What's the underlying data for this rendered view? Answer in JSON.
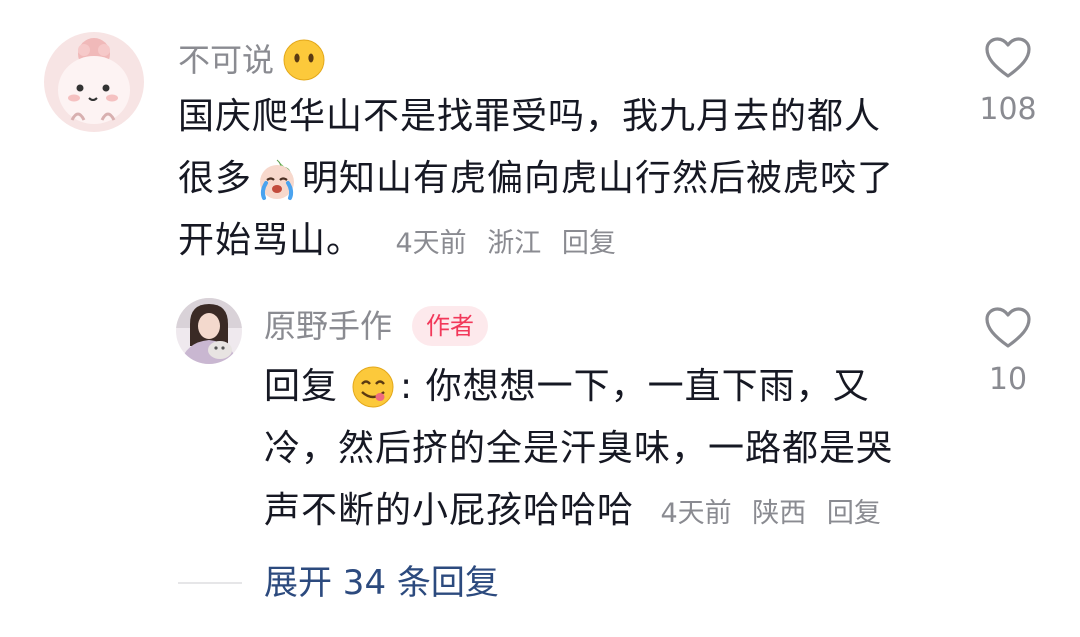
{
  "comment": {
    "username": "不可说",
    "username_emoji": "neutral-face-emoji",
    "lines": [
      "国庆爬华山不是找罪受吗，我九月去的都人",
      "很多",
      "明知山有虎偏向虎山行然后被虎咬了",
      "开始骂山。"
    ],
    "inline_emoji": "crying-face-emoji",
    "time": "4天前",
    "location": "浙江",
    "reply_label": "回复",
    "like_count": "108"
  },
  "reply": {
    "username": "原野手作",
    "badge": "作者",
    "prefix": "回复",
    "prefix_emoji": "yum-face-emoji",
    "lines": [
      ": 你想想一下，一直下雨，又",
      "冷，然后挤的全是汗臭味，一路都是哭",
      "声不断的小屁孩哈哈哈"
    ],
    "time": "4天前",
    "location": "陕西",
    "reply_label": "回复",
    "like_count": "10"
  },
  "expand": {
    "label": "展开 34 条回复"
  },
  "colors": {
    "meta": "#8a8b91",
    "text": "#161823",
    "expand": "#2c4a7e",
    "badge_bg": "#fde9ec",
    "badge_text": "#f2385a"
  }
}
